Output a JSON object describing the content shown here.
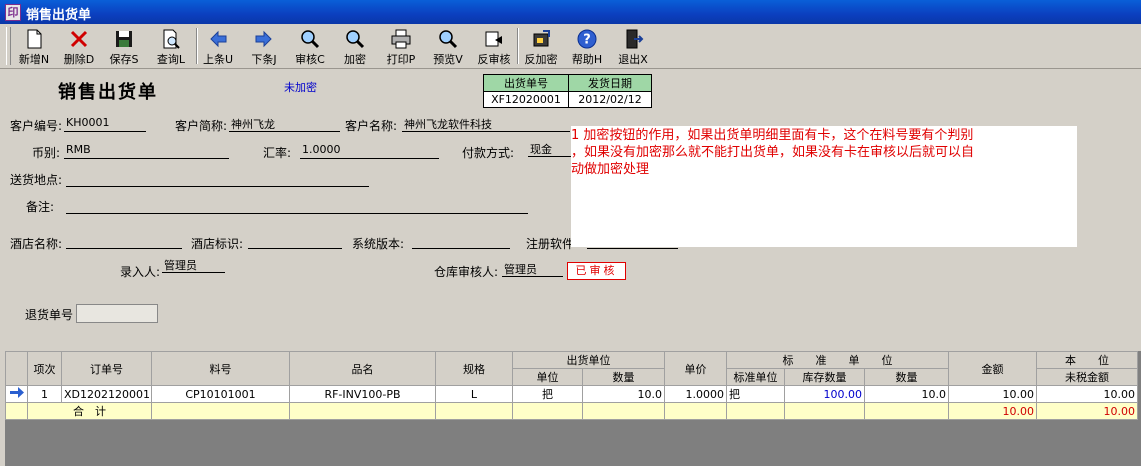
{
  "window": {
    "title": "销售出货单"
  },
  "toolbar": [
    {
      "label": "新增N",
      "icon": "new-document-icon"
    },
    {
      "label": "删除D",
      "icon": "delete-x-icon"
    },
    {
      "label": "保存S",
      "icon": "floppy-save-icon"
    },
    {
      "label": "查询L",
      "icon": "query-magnifier-icon"
    },
    {
      "label": "上条U",
      "icon": "arrow-left-icon"
    },
    {
      "label": "下条J",
      "icon": "arrow-right-icon"
    },
    {
      "label": "审核C",
      "icon": "audit-magnifier-icon"
    },
    {
      "label": "加密",
      "icon": "encrypt-magnifier-icon"
    },
    {
      "label": "打印P",
      "icon": "printer-icon"
    },
    {
      "label": "预览V",
      "icon": "preview-magnifier-icon"
    },
    {
      "label": "反审核",
      "icon": "unaudit-icon"
    },
    {
      "label": "反加密",
      "icon": "decrypt-icon"
    },
    {
      "label": "帮助H",
      "icon": "help-question-icon"
    },
    {
      "label": "退出X",
      "icon": "exit-door-icon"
    }
  ],
  "form": {
    "title": "销售出货单",
    "encrypt_status": "未加密",
    "order_no_label": "出货单号",
    "order_no": "XF12020001",
    "date_label": "发货日期",
    "date": "2012/02/12",
    "customer_code_label": "客户编号:",
    "customer_code": "KH0001",
    "customer_short_label": "客户简称:",
    "customer_short": "神州飞龙",
    "customer_name_label": "客户名称:",
    "customer_name": "神州飞龙软件科技",
    "currency_label": "币别:",
    "currency": "RMB",
    "rate_label": "汇率:",
    "rate": "1.0000",
    "payment_label": "付款方式:",
    "payment": "现金",
    "address_label": "送货地点:",
    "address": "",
    "remark_label": "备注:",
    "remark": "",
    "hotel_name_label": "酒店名称:",
    "hotel_name": "",
    "hotel_id_label": "酒店标识:",
    "hotel_id": "",
    "sys_version_label": "系统版本:",
    "sys_version": "",
    "register_label": "注册软件",
    "register": "",
    "entered_by_label": "录入人:",
    "entered_by": "管理员",
    "warehouse_auditor_label": "仓库审核人:",
    "warehouse_auditor": "管理员",
    "audit_stamp": "已审核",
    "return_no_label": "退货单号",
    "return_no": ""
  },
  "note": {
    "line1": "1 加密按钮的作用，如果出货单明细里面有卡，这个在料号要有个判别",
    "line2": "，如果没有加密那么就不能打出货单，如果没有卡在审核以后就可以自",
    "line3": "动做加密处理"
  },
  "grid": {
    "headers": {
      "seq": "项次",
      "order": "订单号",
      "part": "料号",
      "name": "品名",
      "spec": "规格",
      "ship_unit_group": "出货单位",
      "ship_unit": "单位",
      "ship_qty": "数量",
      "price": "单价",
      "std_group": "标　　准　　单　　位",
      "std_unit": "标准单位",
      "stock_qty": "库存数量",
      "std_qty": "数量",
      "amount": "金额",
      "base_group": "本　　位",
      "untaxed": "未税金额"
    },
    "rows": [
      {
        "seq": "1",
        "order": "XD1202120001",
        "part": "CP10101001",
        "name": "RF-INV100-PB",
        "spec": "L",
        "ship_unit": "把",
        "ship_qty": "10.0",
        "price": "1.0000",
        "std_unit": "把",
        "stock_qty": "100.00",
        "std_qty": "10.0",
        "amount": "10.00",
        "untaxed": "10.00"
      }
    ],
    "total": {
      "label": "合　计",
      "amount": "10.00",
      "untaxed": "10.00"
    }
  },
  "colors": {
    "title_bar": "#0b3fbf",
    "note_text": "#e00000",
    "header_green": "#9fd7a6",
    "total_row": "#ffffc8"
  }
}
